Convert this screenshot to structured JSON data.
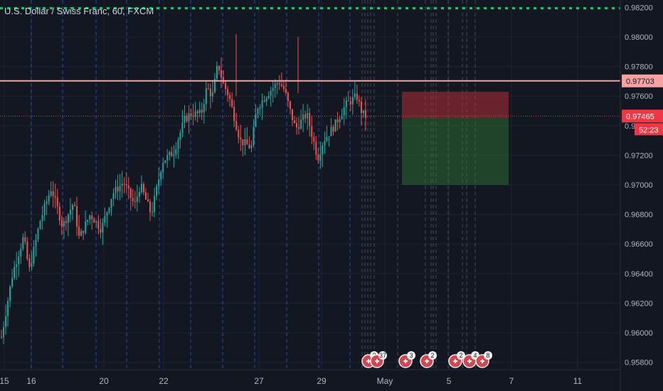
{
  "header": {
    "title": "U.S. Dollar / Swiss Franc, 60, FXCM"
  },
  "colors": {
    "background": "#131722",
    "grid": "#1f2330",
    "up_candle": "#26a69a",
    "down_candle": "#ef5350",
    "resistance_line": "#f7a1a1",
    "dotted_target": "#22c55e",
    "session_divider": "#2962ff",
    "axis_text": "#b2b5be",
    "price_label_current": "#f23645",
    "price_label_resistance": "#f7a1a1",
    "stop_zone": "#b22c34",
    "target_zone": "#2e7d32"
  },
  "chart_data": {
    "type": "candlestick",
    "symbol": "U.S. Dollar / Swiss Franc",
    "timeframe": "60",
    "source": "FXCM",
    "y_axis": {
      "ylim": [
        0.9575,
        0.9825
      ],
      "ticks": [
        "0.98200",
        "0.98000",
        "0.97800",
        "0.97600",
        "0.97400",
        "0.97200",
        "0.97000",
        "0.96800",
        "0.96600",
        "0.96400",
        "0.96200",
        "0.96000",
        "0.95800"
      ]
    },
    "x_axis": {
      "ticks": [
        "15",
        "16",
        "20",
        "22",
        "27",
        "29",
        "May",
        "5",
        "7",
        "11"
      ]
    },
    "price_path_points": [
      [
        0.0,
        0.9597
      ],
      [
        0.02,
        0.964
      ],
      [
        0.04,
        0.9665
      ],
      [
        0.05,
        0.9642
      ],
      [
        0.07,
        0.9676
      ],
      [
        0.09,
        0.9698
      ],
      [
        0.11,
        0.9672
      ],
      [
        0.13,
        0.9688
      ],
      [
        0.14,
        0.9664
      ],
      [
        0.16,
        0.968
      ],
      [
        0.18,
        0.967
      ],
      [
        0.2,
        0.9694
      ],
      [
        0.22,
        0.9702
      ],
      [
        0.24,
        0.9686
      ],
      [
        0.25,
        0.97
      ],
      [
        0.27,
        0.968
      ],
      [
        0.29,
        0.9716
      ],
      [
        0.31,
        0.9722
      ],
      [
        0.33,
        0.9744
      ],
      [
        0.34,
        0.9748
      ],
      [
        0.36,
        0.9748
      ],
      [
        0.37,
        0.9766
      ],
      [
        0.38,
        0.976
      ],
      [
        0.39,
        0.9782
      ],
      [
        0.4,
        0.9768
      ],
      [
        0.41,
        0.976
      ],
      [
        0.43,
        0.973
      ],
      [
        0.45,
        0.9725
      ],
      [
        0.46,
        0.9752
      ],
      [
        0.48,
        0.9762
      ],
      [
        0.5,
        0.977
      ],
      [
        0.51,
        0.9764
      ],
      [
        0.52,
        0.975
      ],
      [
        0.53,
        0.9738
      ],
      [
        0.55,
        0.9748
      ],
      [
        0.57,
        0.9718
      ],
      [
        0.58,
        0.973
      ],
      [
        0.6,
        0.974
      ],
      [
        0.62,
        0.9754
      ],
      [
        0.64,
        0.976
      ],
      [
        0.65,
        0.9748
      ],
      [
        0.66,
        0.9746
      ]
    ],
    "horizontal_lines": [
      {
        "label": "0.97703",
        "value": 0.97703,
        "style": "solid"
      },
      {
        "label": "0.98200",
        "value": 0.98195,
        "style": "dotted"
      },
      {
        "label": "0.97465",
        "value": 0.97465,
        "style": "dashed-fine"
      }
    ],
    "price_labels": {
      "resistance": "0.97703",
      "current": "0.97465",
      "countdown": "52:23"
    },
    "position_tool": {
      "entry": 0.9745,
      "stop": 0.9763,
      "target": 0.97
    },
    "event_markers": [
      {
        "x_fraction": 0.548,
        "count": "2"
      },
      {
        "x_fraction": 0.56,
        "count": "37"
      },
      {
        "x_fraction": 0.61,
        "count": "3"
      },
      {
        "x_fraction": 0.65,
        "count": "2"
      },
      {
        "x_fraction": 0.695,
        "count": "2"
      },
      {
        "x_fraction": 0.712,
        "count": "4"
      },
      {
        "x_fraction": 0.728,
        "count": "8"
      }
    ]
  }
}
